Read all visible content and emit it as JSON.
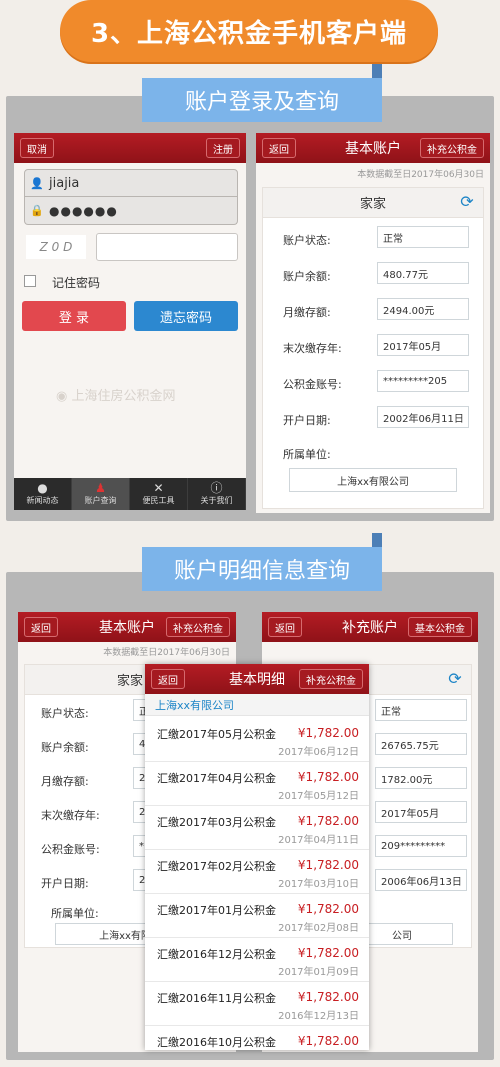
{
  "banner": {
    "title": "3、上海公积金手机客户端"
  },
  "section1": {
    "tag": "账户登录及查询"
  },
  "section2": {
    "tag": "账户明细信息查询"
  },
  "login": {
    "cancel": "取消",
    "register": "注册",
    "username": "jiajia",
    "password": "●●●●●●",
    "captcha": "Z 0 D",
    "remember": "记住密码",
    "login_btn": "登 录",
    "forgot_btn": "遗忘密码",
    "watermark": "上海住房公积金网",
    "nav": [
      "新闻动态",
      "账户查询",
      "便民工具",
      "关于我们"
    ]
  },
  "basic_account": {
    "back": "返回",
    "title": "基本账户",
    "supp": "补充公积金",
    "note": "本数据截至日2017年06月30日",
    "owner": "家家",
    "labels": [
      "账户状态:",
      "账户余额:",
      "月缴存额:",
      "末次缴存年:",
      "公积金账号:",
      "开户日期:",
      "所属单位:"
    ],
    "values": [
      "正常",
      "480.77元",
      "2494.00元",
      "2017年05月",
      "*********205",
      "2002年06月11日",
      "上海xx有限公司"
    ]
  },
  "basic_account_2": {
    "back": "返回",
    "title": "基本账户",
    "supp": "补充公积金",
    "note": "本数据截至日2017年06月30日",
    "owner": "家家",
    "labels": [
      "账户状态:",
      "账户余额:",
      "月缴存额:",
      "末次缴存年:",
      "公积金账号:",
      "开户日期:",
      "所属单位:"
    ],
    "values": [
      "正",
      "48",
      "24",
      "20",
      "*",
      "20",
      "上海xx有限公"
    ]
  },
  "supp_account": {
    "back": "返回",
    "title": "补充账户",
    "basic": "基本公积金",
    "values": [
      "正常",
      "26765.75元",
      "1782.00元",
      "2017年05月",
      "209*********",
      "2006年06月13日",
      "公司"
    ]
  },
  "detail": {
    "back": "返回",
    "title": "基本明细",
    "supp": "补充公积金",
    "company": "上海xx有限公司",
    "rows": [
      {
        "label": "汇缴2017年05月公积金",
        "amount": "¥1,782.00",
        "date": "2017年06月12日"
      },
      {
        "label": "汇缴2017年04月公积金",
        "amount": "¥1,782.00",
        "date": "2017年05月12日"
      },
      {
        "label": "汇缴2017年03月公积金",
        "amount": "¥1,782.00",
        "date": "2017年04月11日"
      },
      {
        "label": "汇缴2017年02月公积金",
        "amount": "¥1,782.00",
        "date": "2017年03月10日"
      },
      {
        "label": "汇缴2017年01月公积金",
        "amount": "¥1,782.00",
        "date": "2017年02月08日"
      },
      {
        "label": "汇缴2016年12月公积金",
        "amount": "¥1,782.00",
        "date": "2017年01月09日"
      },
      {
        "label": "汇缴2016年11月公积金",
        "amount": "¥1,782.00",
        "date": "2016年12月13日"
      },
      {
        "label": "汇缴2016年10月公积金",
        "amount": "¥1,782.00",
        "date": ""
      }
    ]
  }
}
